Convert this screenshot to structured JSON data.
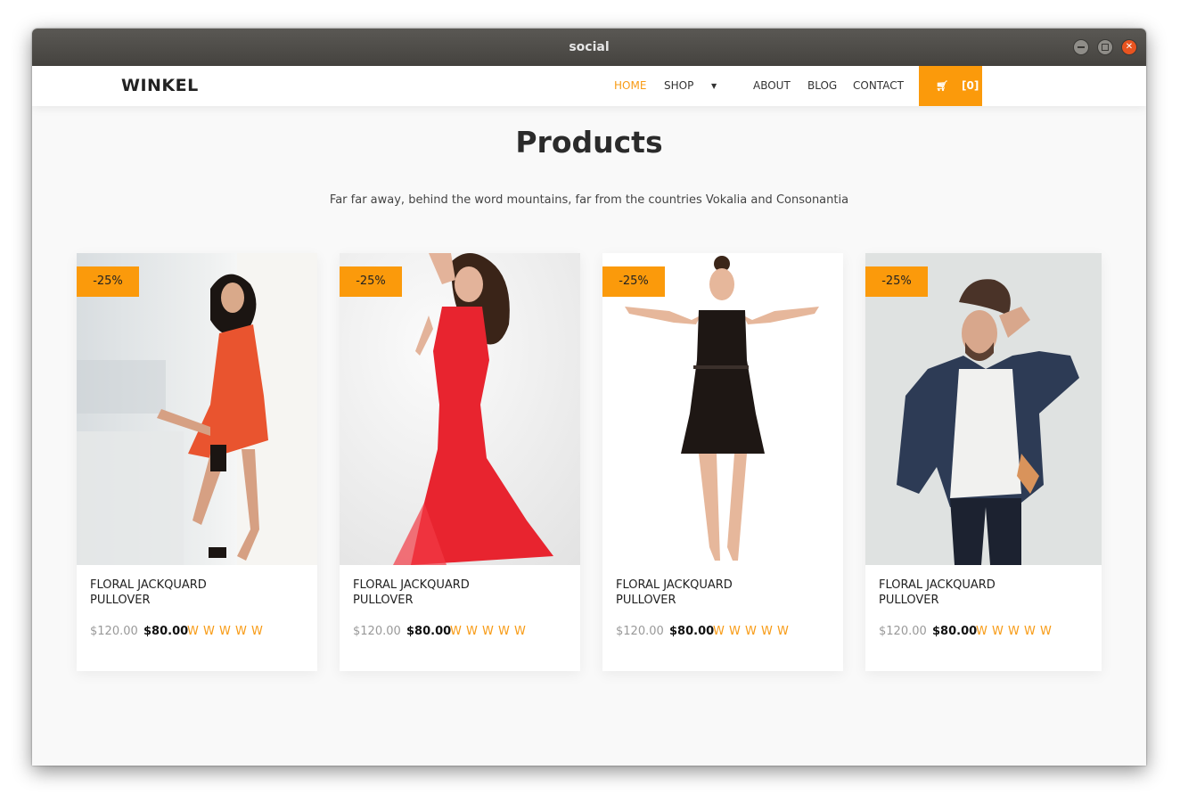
{
  "window": {
    "title": "social"
  },
  "navbar": {
    "brand": "WINKEL",
    "items": [
      {
        "label": "HOME",
        "active": true
      },
      {
        "label": "SHOP",
        "active": false
      },
      {
        "label": "ABOUT",
        "active": false
      },
      {
        "label": "BLOG",
        "active": false
      },
      {
        "label": "CONTACT",
        "active": false
      }
    ],
    "cart_count": "[0]"
  },
  "page": {
    "heading": "Products",
    "subheading": "Far far away, behind the word mountains, far from the countries Vokalia and Consonantia"
  },
  "products": [
    {
      "badge": "-25%",
      "title_line1": "FLORAL JACKQUARD",
      "title_line2": "PULLOVER",
      "price_old": "$120.00",
      "price_new": "$80.00",
      "rating": "W W W W W",
      "image": "woman in orange dress"
    },
    {
      "badge": "-25%",
      "title_line1": "FLORAL JACKQUARD",
      "title_line2": "PULLOVER",
      "price_old": "$120.00",
      "price_new": "$80.00",
      "rating": "W W W W W",
      "image": "woman in red gown"
    },
    {
      "badge": "-25%",
      "title_line1": "FLORAL JACKQUARD",
      "title_line2": "PULLOVER",
      "price_old": "$120.00",
      "price_new": "$80.00",
      "rating": "W W W W W",
      "image": "woman in black dress"
    },
    {
      "badge": "-25%",
      "title_line1": "FLORAL JACKQUARD",
      "title_line2": "PULLOVER",
      "price_old": "$120.00",
      "price_new": "$80.00",
      "rating": "W W W W W",
      "image": "man in denim jacket"
    }
  ],
  "colors": {
    "accent": "#fb9a0b",
    "nav_active": "#f89b15",
    "page_bg": "#f9f9f9",
    "titlebar": "#4f4d49",
    "close_button": "#e95420"
  },
  "icons": {
    "cart": "cart-icon",
    "dropdown": "caret-down-icon",
    "window_close": "close-icon",
    "window_minimize": "minimize-icon",
    "window_maximize": "maximize-icon"
  }
}
